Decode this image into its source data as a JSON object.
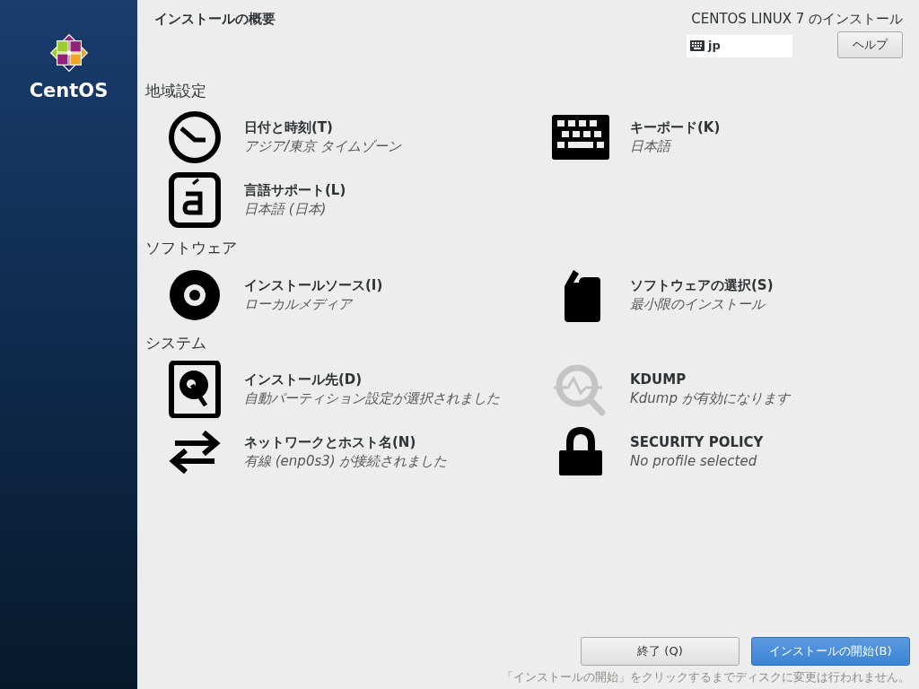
{
  "sidebar": {
    "logo_text": "CentOS"
  },
  "header": {
    "title": "インストールの概要",
    "product": "CENTOS LINUX 7 のインストール",
    "keyboard_layout": "jp",
    "help_button": "ヘルプ"
  },
  "sections": [
    {
      "title": "地域設定",
      "spokes": [
        {
          "kind": "clock",
          "title": "日付と時刻(T)",
          "status": "アジア/東京 タイムゾーン",
          "dimmed": false
        },
        {
          "kind": "keyboard",
          "title": "キーボード(K)",
          "status": "日本語",
          "dimmed": false
        },
        {
          "kind": "language",
          "title": "言語サポート(L)",
          "status": "日本語 (日本)",
          "dimmed": false
        }
      ]
    },
    {
      "title": "ソフトウェア",
      "spokes": [
        {
          "kind": "disc",
          "title": "インストールソース(I)",
          "status": "ローカルメディア",
          "dimmed": false
        },
        {
          "kind": "package",
          "title": "ソフトウェアの選択(S)",
          "status": "最小限のインストール",
          "dimmed": false
        }
      ]
    },
    {
      "title": "システム",
      "spokes": [
        {
          "kind": "disk",
          "title": "インストール先(D)",
          "status": "自動パーティション設定が選択されました",
          "dimmed": false
        },
        {
          "kind": "kdump",
          "title": "KDUMP",
          "status": "Kdump が有効になります",
          "dimmed": true
        },
        {
          "kind": "network",
          "title": "ネットワークとホスト名(N)",
          "status": "有線 (enp0s3) が接続されました",
          "dimmed": false
        },
        {
          "kind": "lock",
          "title": "SECURITY POLICY",
          "status": "No profile selected",
          "dimmed": false
        }
      ]
    }
  ],
  "footer": {
    "quit_button": "終了 (Q)",
    "begin_button": "インストールの開始(B)",
    "note": "「インストールの開始」をクリックするまでディスクに変更は行われません。"
  }
}
